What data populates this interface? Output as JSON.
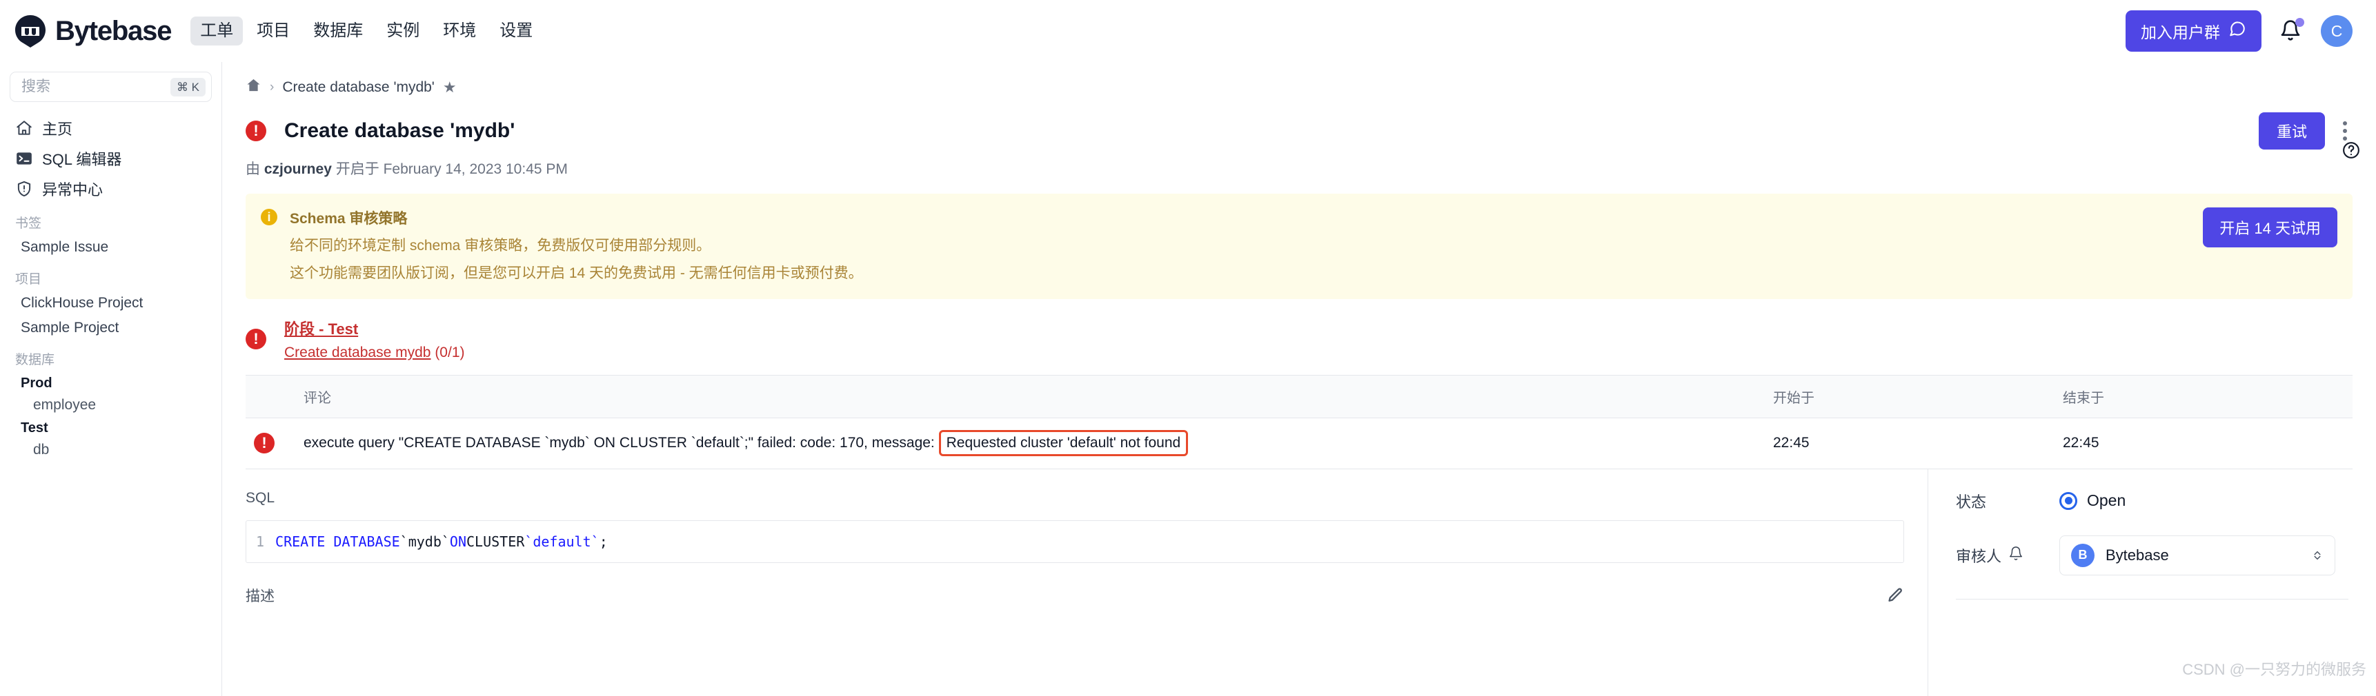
{
  "header": {
    "brand_name": "Bytebase",
    "brand_logo_icon": "bytebase-logo-icon",
    "nav": [
      {
        "label": "工单",
        "active": true
      },
      {
        "label": "项目",
        "active": false
      },
      {
        "label": "数据库",
        "active": false
      },
      {
        "label": "实例",
        "active": false
      },
      {
        "label": "环境",
        "active": false
      },
      {
        "label": "设置",
        "active": false
      }
    ],
    "join_button_label": "加入用户群",
    "join_button_icon": "chat-bubble-icon",
    "bell_icon": "bell-icon",
    "avatar_initial": "C"
  },
  "sidebar": {
    "search": {
      "placeholder": "搜索",
      "value": "",
      "shortcut": "⌘ K"
    },
    "nav": [
      {
        "label": "主页",
        "icon": "home-icon"
      },
      {
        "label": "SQL 编辑器",
        "icon": "terminal-icon"
      },
      {
        "label": "异常中心",
        "icon": "shield-alert-icon"
      }
    ],
    "bookmarks_group": "书签",
    "bookmarks": [
      {
        "label": "Sample Issue"
      }
    ],
    "projects_group": "项目",
    "projects": [
      {
        "label": "ClickHouse Project"
      },
      {
        "label": "Sample Project"
      }
    ],
    "databases_group": "数据库",
    "environments": [
      {
        "name": "Prod",
        "databases": [
          {
            "label": "employee"
          }
        ]
      },
      {
        "name": "Test",
        "databases": [
          {
            "label": "db"
          }
        ]
      }
    ]
  },
  "content": {
    "help_icon": "question-circle-icon",
    "breadcrumb": {
      "home_icon": "home-icon",
      "separator": "›",
      "current": "Create database 'mydb'",
      "star_icon": "star-icon",
      "star_glyph": "★"
    },
    "issue": {
      "status_icon": "error-exclamation-icon",
      "status_glyph": "!",
      "title": "Create database 'mydb'",
      "retry_label": "重试",
      "more_icon": "more-vertical-icon",
      "subtitle_prefix": "由",
      "creator": "czjourney",
      "subtitle_mid": "开启于",
      "created_at": "February 14, 2023 10:45 PM"
    },
    "notice": {
      "icon": "info-circle-icon",
      "icon_glyph": "i",
      "title": "Schema 审核策略",
      "line1": "给不同的环境定制 schema 审核策略，免费版仅可使用部分规则。",
      "line2": "这个功能需要团队版订阅，但是您可以开启 14 天的免费试用 - 无需任何信用卡或预付费。",
      "cta_label": "开启 14 天试用",
      "bg_color": "#fefce8",
      "accent_color": "#eab308"
    },
    "stage": {
      "status_icon": "error-exclamation-icon",
      "status_glyph": "!",
      "name": "阶段 - Test",
      "task_name": "Create database mydb",
      "task_progress": "(0/1)",
      "color": "#c53030"
    },
    "task_table": {
      "columns": [
        "",
        "评论",
        "开始于",
        "结束于"
      ],
      "rows": [
        {
          "status_icon": "error-exclamation-icon",
          "status_glyph": "!",
          "comment_prefix": "execute query \"CREATE DATABASE `mydb` ON CLUSTER `default`;\" failed: code: 170, message:",
          "comment_highlight": "Requested cluster 'default' not found",
          "started_at": "22:45",
          "ended_at": "22:45",
          "highlight_color": "#e8492b"
        }
      ]
    },
    "sql_section": {
      "label": "SQL",
      "line_number": "1",
      "tokens": [
        {
          "text": "CREATE DATABASE ",
          "type": "kw"
        },
        {
          "text": "`mydb` ",
          "type": "tok"
        },
        {
          "text": "ON ",
          "type": "kw"
        },
        {
          "text": "CLUSTER ",
          "type": "tok"
        },
        {
          "text": "`default`",
          "type": "str"
        },
        {
          "text": ";",
          "type": "tok"
        }
      ],
      "full_sql": "CREATE DATABASE `mydb` ON CLUSTER `default`;"
    },
    "description_section": {
      "label": "描述",
      "edit_icon": "pencil-icon"
    }
  },
  "right_panel": {
    "status_label": "状态",
    "status_value": "Open",
    "status_radio_icon": "radio-selected-icon",
    "assignee_label": "审核人",
    "assignee_bell_icon": "bell-outline-icon",
    "assignee_avatar_initial": "B",
    "assignee_value": "Bytebase",
    "assignee_chevron_icon": "chevron-up-down-icon"
  },
  "watermark": "CSDN @一只努力的微服务",
  "colors": {
    "primary": "#4f46e5",
    "danger": "#dc2626",
    "stage_red": "#c53030",
    "warning": "#eab308",
    "highlight": "#e8492b",
    "blue_accent": "#2563eb"
  }
}
